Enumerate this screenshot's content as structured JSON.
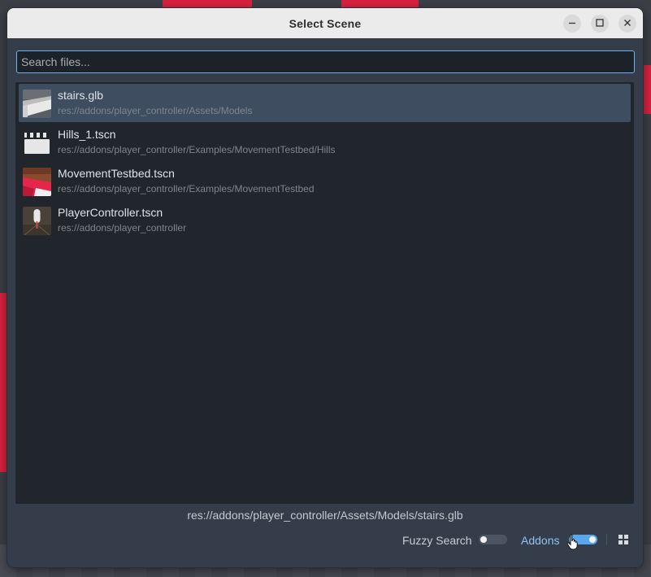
{
  "window": {
    "title": "Select Scene"
  },
  "search": {
    "placeholder": "Search files..."
  },
  "results": [
    {
      "name": "stairs.glb",
      "path": "res://addons/player_controller/Assets/Models",
      "thumbnail": "stairs-thumbnail",
      "selected": true
    },
    {
      "name": "Hills_1.tscn",
      "path": "res://addons/player_controller/Examples/MovementTestbed/Hills",
      "thumbnail": "clapperboard-icon",
      "selected": false
    },
    {
      "name": "MovementTestbed.tscn",
      "path": "res://addons/player_controller/Examples/MovementTestbed",
      "thumbnail": "testbed-thumbnail",
      "selected": false
    },
    {
      "name": "PlayerController.tscn",
      "path": "res://addons/player_controller",
      "thumbnail": "player-thumbnail",
      "selected": false
    }
  ],
  "status": {
    "selected_path": "res://addons/player_controller/Assets/Models/stairs.glb"
  },
  "options": {
    "fuzzy_search_label": "Fuzzy Search",
    "fuzzy_search_enabled": false,
    "addons_label": "Addons",
    "addons_enabled": true
  },
  "colors": {
    "accent": "#6ab2f2",
    "selected_row": "#3e4d60",
    "background_red": "#d8223f"
  }
}
